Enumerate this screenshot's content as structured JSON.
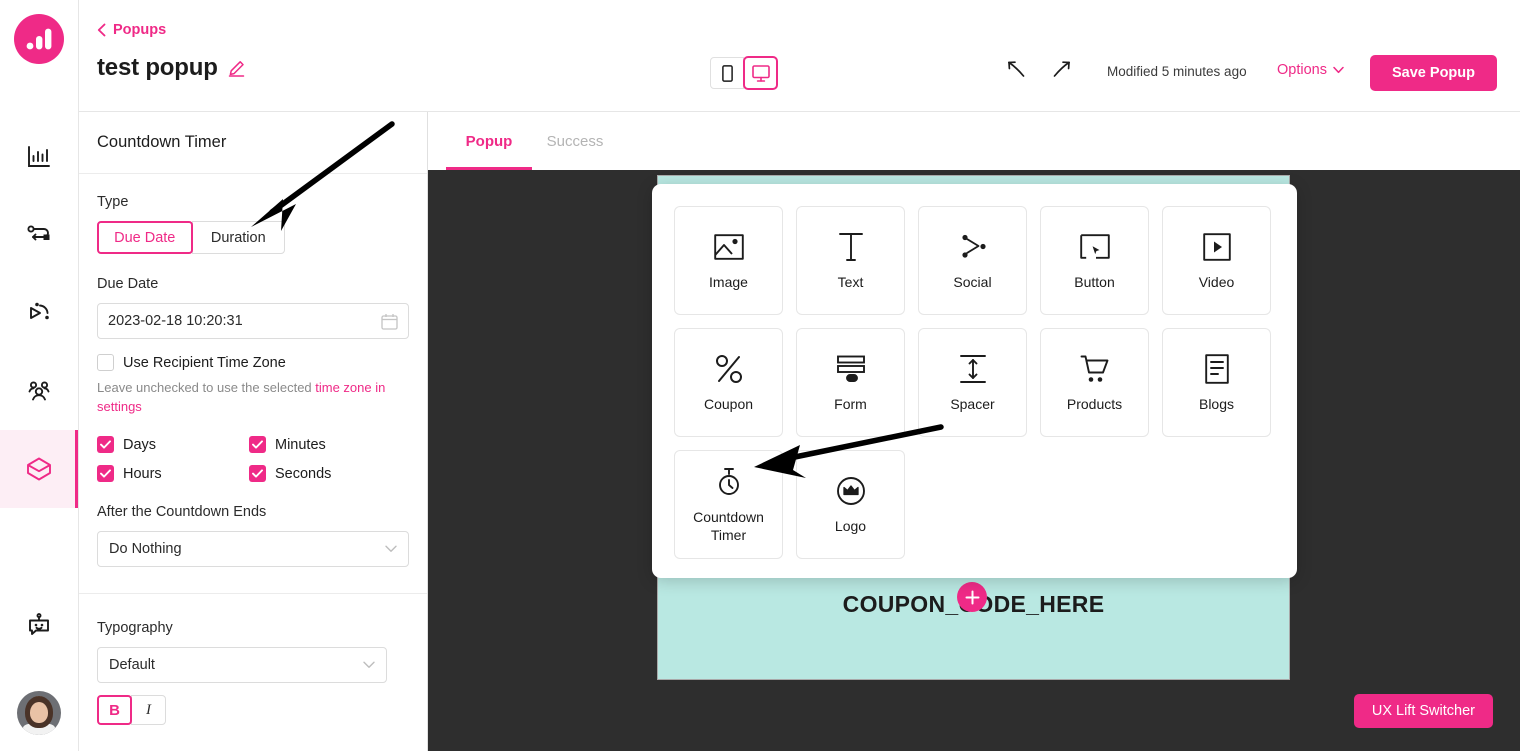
{
  "brand": {
    "logo_icon": "bar-chart-logo",
    "color": "#ef2a87"
  },
  "rail": {
    "items": [
      {
        "name": "analytics",
        "icon": "bar-chart-icon"
      },
      {
        "name": "flows",
        "icon": "flow-route-icon"
      },
      {
        "name": "campaigns",
        "icon": "send-campaign-icon"
      },
      {
        "name": "audience",
        "icon": "people-group-icon"
      },
      {
        "name": "popups",
        "icon": "box-cube-icon",
        "active": true
      },
      {
        "name": "chatbot",
        "icon": "robot-icon"
      }
    ],
    "avatar_name": "user-avatar"
  },
  "header": {
    "breadcrumb": "Popups",
    "back_icon": "chevron-left-icon",
    "title": "test popup",
    "edit_icon": "pencil-edit-icon",
    "device_mobile_icon": "mobile-device-icon",
    "device_desktop_icon": "desktop-device-icon",
    "active_device": "desktop",
    "undo_icon": "undo-arrow-icon",
    "redo_icon": "redo-arrow-icon",
    "modified_text": "Modified 5 minutes ago",
    "options_label": "Options",
    "options_caret_icon": "chevron-down-icon",
    "save_label": "Save Popup"
  },
  "panel": {
    "heading": "Countdown Timer",
    "type": {
      "label": "Type",
      "options": [
        "Due Date",
        "Duration"
      ],
      "selected": "Due Date"
    },
    "due_date": {
      "label": "Due Date",
      "value": "2023-02-18 10:20:31",
      "calendar_icon": "calendar-icon"
    },
    "recipient_tz": {
      "label": "Use Recipient Time Zone",
      "checked": false,
      "helper_prefix": "Leave unchecked to use the selected ",
      "helper_link": "time zone in settings"
    },
    "units": [
      {
        "label": "Days",
        "checked": true
      },
      {
        "label": "Minutes",
        "checked": true
      },
      {
        "label": "Hours",
        "checked": true
      },
      {
        "label": "Seconds",
        "checked": true
      }
    ],
    "after_end": {
      "label": "After the Countdown Ends",
      "value": "Do Nothing",
      "caret_icon": "chevron-down-icon"
    },
    "typography": {
      "label": "Typography",
      "value": "Default",
      "caret_icon": "chevron-down-icon",
      "bold_label": "B",
      "italic_label": "I",
      "bold_active": true
    }
  },
  "canvas": {
    "tabs": [
      {
        "label": "Popup",
        "active": true
      },
      {
        "label": "Success",
        "active": false
      }
    ],
    "coupon_text": "COUPON_CODE_HERE",
    "add_block_icon": "plus-circle-icon",
    "ux_switcher_label": "UX Lift Switcher",
    "popup_bg": "#b9e8e2",
    "canvas_bg": "#2e2e2e"
  },
  "picker": {
    "elements": [
      {
        "label": "Image",
        "icon": "image-icon"
      },
      {
        "label": "Text",
        "icon": "text-t-icon"
      },
      {
        "label": "Social",
        "icon": "social-share-icon"
      },
      {
        "label": "Button",
        "icon": "button-cursor-icon"
      },
      {
        "label": "Video",
        "icon": "video-play-icon"
      },
      {
        "label": "Coupon",
        "icon": "percent-icon"
      },
      {
        "label": "Form",
        "icon": "form-lines-icon"
      },
      {
        "label": "Spacer",
        "icon": "spacer-arrows-icon"
      },
      {
        "label": "Products",
        "icon": "shopping-cart-icon"
      },
      {
        "label": "Blogs",
        "icon": "document-lines-icon"
      },
      {
        "label": "Countdown Timer",
        "icon": "stopwatch-icon"
      },
      {
        "label": "Logo",
        "icon": "crown-circle-icon"
      }
    ]
  },
  "annotations": [
    {
      "name": "arrow-to-type-toggle"
    },
    {
      "name": "arrow-to-countdown-timer"
    }
  ]
}
